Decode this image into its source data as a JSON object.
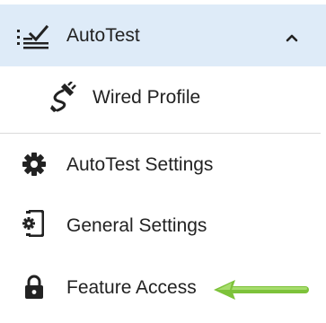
{
  "menu": {
    "autotest": {
      "label": "AutoTest",
      "icon": "autotest-checklist-icon",
      "expanded": true,
      "chevron_icon": "chevron-up-icon",
      "highlight_color": "#deebf8"
    },
    "wired_profile": {
      "label": "Wired Profile",
      "icon": "ethernet-cable-icon"
    },
    "autotest_settings": {
      "label": "AutoTest Settings",
      "icon": "gear-icon"
    },
    "general_settings": {
      "label": "General Settings",
      "icon": "device-settings-icon"
    },
    "feature_access": {
      "label": "Feature Access",
      "icon": "lock-icon"
    }
  },
  "annotation": {
    "icon": "green-arrow-icon",
    "color": "#7dc23a"
  }
}
